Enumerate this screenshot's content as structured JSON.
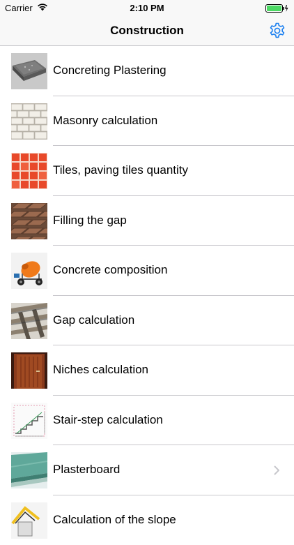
{
  "status": {
    "carrier": "Carrier",
    "time": "2:10 PM"
  },
  "nav": {
    "title": "Construction",
    "settings_icon": "gear-icon"
  },
  "items": [
    {
      "label": "Concreting Plastering",
      "icon": "concrete-slab-thumbnail"
    },
    {
      "label": "Masonry calculation",
      "icon": "brick-wall-thumbnail"
    },
    {
      "label": "Tiles, paving tiles quantity",
      "icon": "red-tiles-thumbnail"
    },
    {
      "label": "Filling the gap",
      "icon": "paving-bricks-thumbnail"
    },
    {
      "label": "Concrete composition",
      "icon": "concrete-mixer-thumbnail"
    },
    {
      "label": "Gap calculation",
      "icon": "floor-joists-thumbnail"
    },
    {
      "label": "Niches calculation",
      "icon": "wooden-door-thumbnail"
    },
    {
      "label": "Stair-step calculation",
      "icon": "stair-diagram-thumbnail"
    },
    {
      "label": "Plasterboard",
      "icon": "plasterboard-thumbnail"
    },
    {
      "label": "Calculation of the slope",
      "icon": "roof-slope-thumbnail"
    }
  ],
  "colors": {
    "accent": "#1a7ff0",
    "separator": "#c8c7cc",
    "bar_background": "#f8f8f8",
    "battery": "#4cd964"
  }
}
